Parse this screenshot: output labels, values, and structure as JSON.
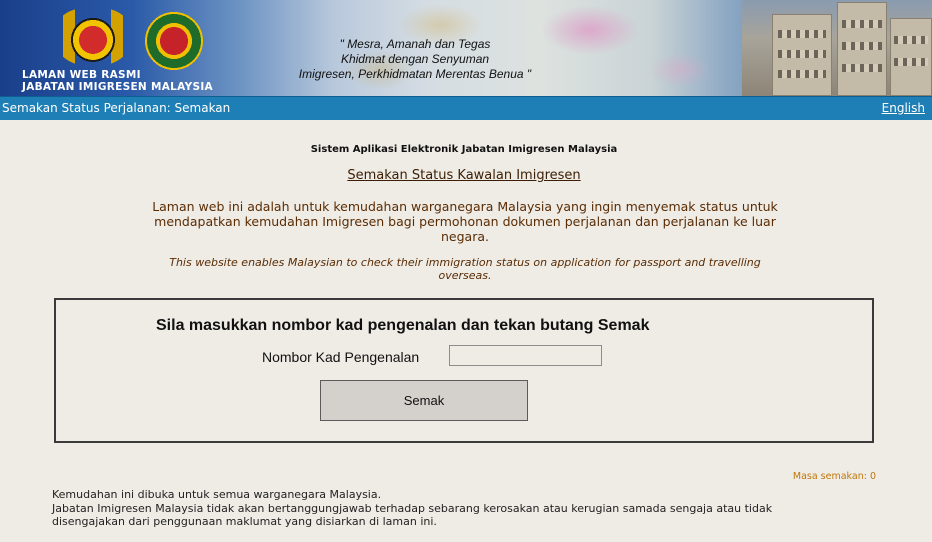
{
  "header": {
    "site_title_line1": "LAMAN WEB RASMI",
    "site_title_line2": "JABATAN IMIGRESEN MALAYSIA",
    "motto_line1": "\" Mesra, Amanah dan Tegas",
    "motto_line2": "Khidmat dengan Senyuman",
    "motto_line3": "Imigresen, Perkhidmatan Merentas Benua \""
  },
  "navbar": {
    "title": "Semakan Status Perjalanan: Semakan",
    "language_link": "English"
  },
  "content": {
    "system_name": "Sistem Aplikasi Elektronik Jabatan Imigresen Malaysia",
    "heading": "Semakan Status Kawalan Imigresen",
    "intro_ms": "Laman web ini adalah untuk kemudahan warganegara Malaysia yang ingin menyemak status untuk mendapatkan kemudahan Imigresen bagi permohonan dokumen perjalanan dan perjalanan ke luar negara.",
    "intro_en": "This website enables Malaysian to check their immigration status on application for passport and travelling overseas."
  },
  "form": {
    "prompt": "Sila masukkan nombor kad pengenalan dan tekan butang Semak",
    "ic_label": "Nombor Kad Pengenalan",
    "ic_value": "",
    "submit_label": "Semak"
  },
  "status": {
    "check_count_label": "Masa semakan: 0"
  },
  "footer": {
    "line1": "Kemudahan ini dibuka untuk semua warganegara Malaysia.",
    "line2": "Jabatan Imigresen Malaysia tidak akan bertanggungjawab terhadap sebarang kerosakan atau kerugian samada sengaja atau tidak disengajakan dari penggunaan maklumat yang disiarkan di laman ini."
  },
  "colors": {
    "navbar": "#1e7fb6",
    "page_background": "#efece6",
    "heading_brown": "#5a2c04",
    "count_orange": "#c1760a"
  }
}
